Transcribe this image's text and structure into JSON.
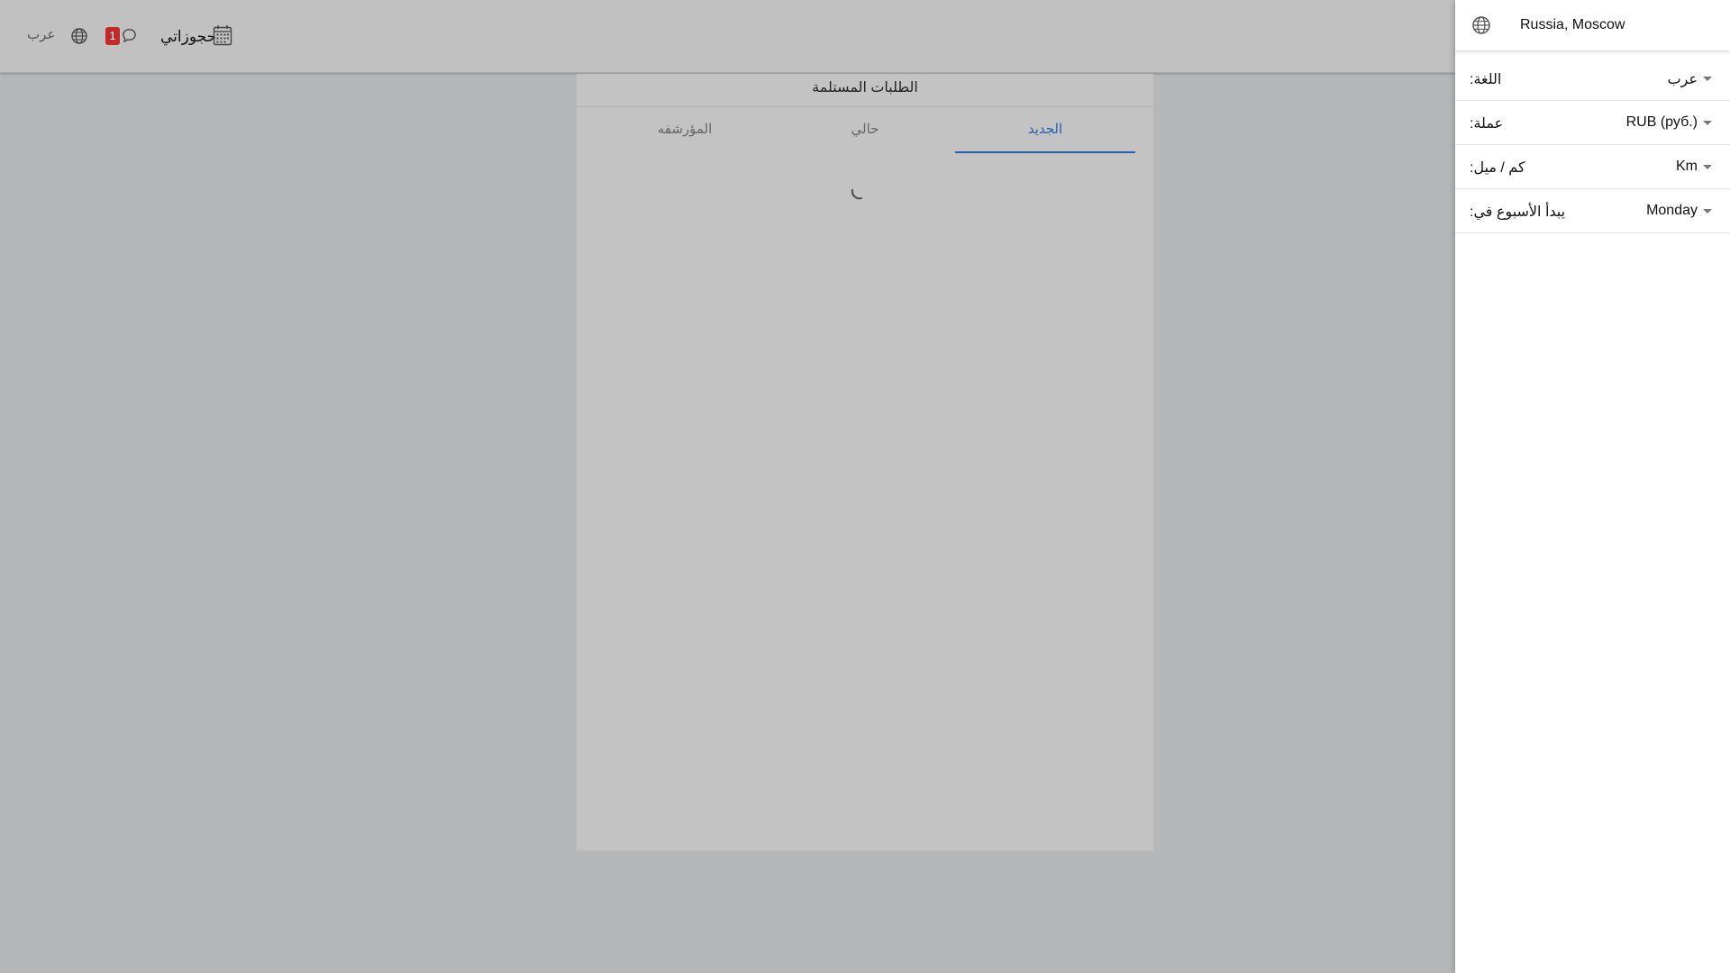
{
  "header": {
    "lang_label": "عرب",
    "notification_count": "1",
    "bookings_label": "حجوزاتي"
  },
  "panel": {
    "title": "الطلبات المستلمة",
    "tabs": [
      {
        "label": "المؤرشفه",
        "active": false
      },
      {
        "label": "حالي",
        "active": false
      },
      {
        "label": "الجديد",
        "active": true
      }
    ],
    "loading": true
  },
  "drawer": {
    "location": "Russia, Moscow",
    "settings": [
      {
        "label": ":اللغة",
        "value": "عرب"
      },
      {
        "label": ":عملة",
        "value": "RUB (руб.)"
      },
      {
        "label": ":كم / ميل",
        "value": "Km"
      },
      {
        "label": ":يبدأ الأسبوع في",
        "value": "Monday"
      }
    ]
  },
  "colors": {
    "accent": "#2a5fb0",
    "badge": "#c62828",
    "overlay": "#b6b7b9"
  }
}
